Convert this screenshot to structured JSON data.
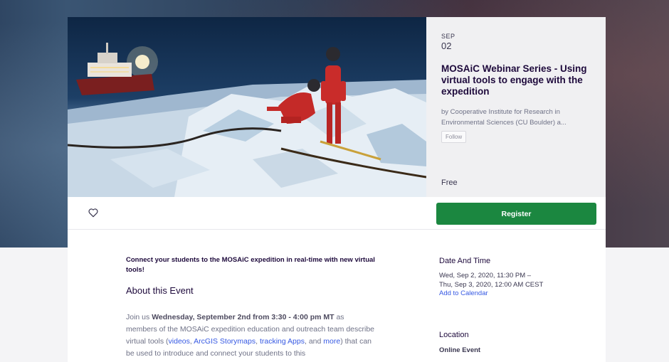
{
  "event": {
    "month": "SEP",
    "day": "02",
    "title": "MOSAiC Webinar Series - Using virtual tools to engage with the expedition",
    "organizer": "by Cooperative Institute for Research in Environmental Sciences (CU Boulder) a...",
    "follow_label": "Follow",
    "price": "Free",
    "register_label": "Register"
  },
  "content": {
    "tagline": "Connect your students to the MOSAiC expedition in real-time with new virtual tools!",
    "about_heading": "About this Event",
    "desc": {
      "p1": "Join us ",
      "p1_bold": "Wednesday, September 2nd from 3:30 - 4:00 pm MT",
      "p2": " as members of the MOSAiC expedition education and outreach team describe virtual tools (",
      "link1": "videos",
      "sep1": ", ",
      "link2": "ArcGIS Storymaps",
      "sep2": ", ",
      "link3": "tracking Apps",
      "sep3": ", and ",
      "link4": "more",
      "p3": ") that can be used to introduce and connect your students to this"
    }
  },
  "sidebar": {
    "date_heading": "Date And Time",
    "date_line1": "Wed, Sep 2, 2020, 11:30 PM –",
    "date_line2": "Thu, Sep 3, 2020, 12:00 AM CEST",
    "add_calendar": "Add to Calendar",
    "location_heading": "Location",
    "location_value": "Online Event"
  },
  "colors": {
    "register": "#1b8740",
    "link": "#3659e3",
    "info_panel": "#f0f0f2"
  },
  "icons": {
    "like": "heart-icon"
  }
}
